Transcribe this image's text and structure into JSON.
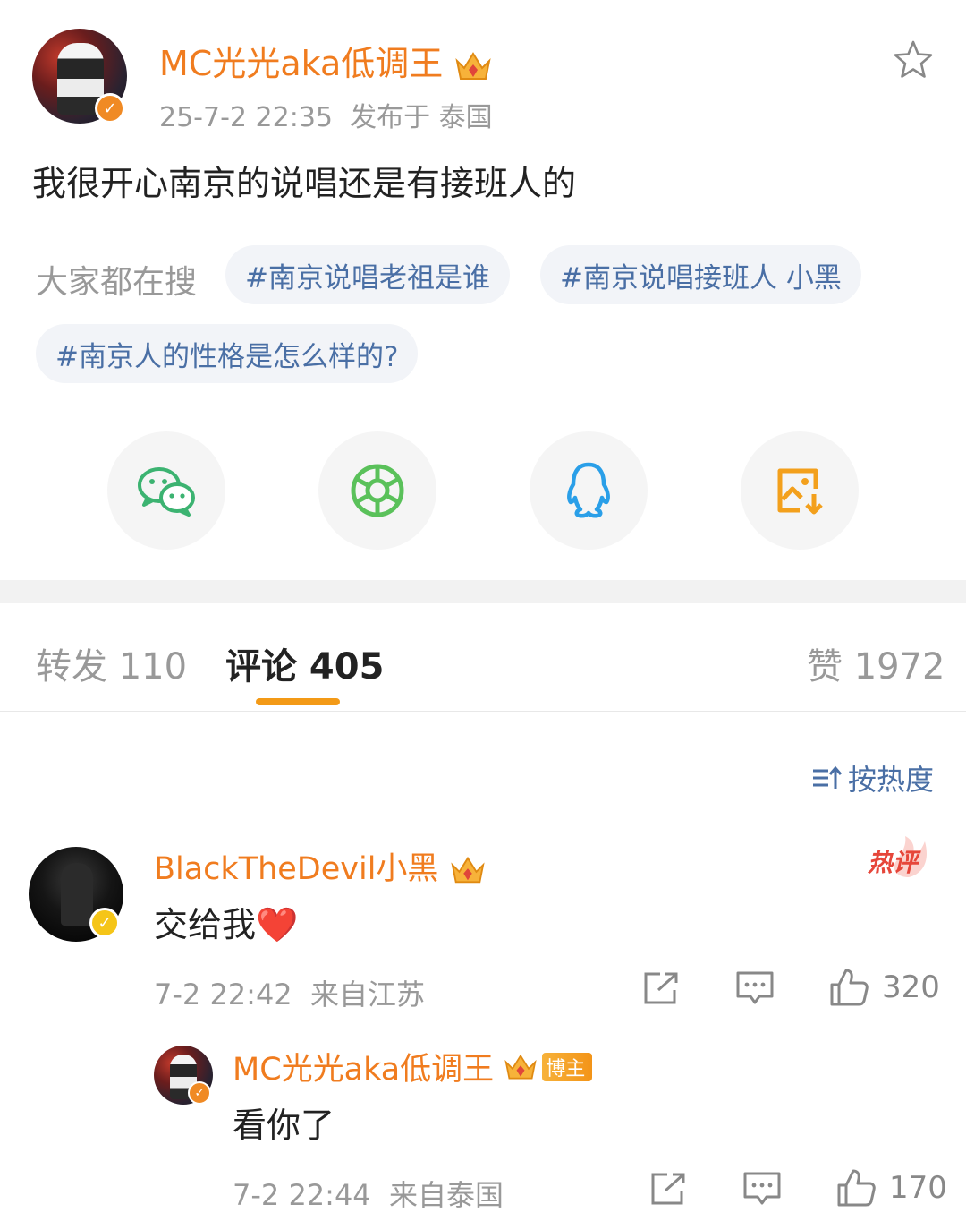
{
  "post": {
    "author": "MC光光aka低调王",
    "timestamp": "25-7-2 22:35",
    "location": "发布于 泰国",
    "text": "我很开心南京的说唱还是有接班人的"
  },
  "search": {
    "label": "大家都在搜",
    "tags": [
      "#南京说唱老祖是谁",
      "#南京说唱接班人 小黑",
      "#南京人的性格是怎么样的?"
    ]
  },
  "share_icons": [
    "wechat-icon",
    "moments-icon",
    "qq-icon",
    "save-image-icon"
  ],
  "tabs": {
    "repost": "转发 110",
    "comments": "评论 405",
    "likes": "赞 1972"
  },
  "sort_label": "按热度",
  "comments": [
    {
      "author": "BlackTheDevil小黑",
      "text": "交给我",
      "emoji": "❤️",
      "hot_label": "热评",
      "time": "7-2 22:42",
      "location": "来自江苏",
      "likes": "320",
      "reply": {
        "author": "MC光光aka低调王",
        "badge": "博主",
        "text": "看你了",
        "time": "7-2 22:44",
        "location": "来自泰国",
        "likes": "170"
      }
    }
  ],
  "colors": {
    "username": "#f07c1f",
    "link": "#4a6fa5",
    "muted": "#999999",
    "accent": "#f39a17"
  }
}
